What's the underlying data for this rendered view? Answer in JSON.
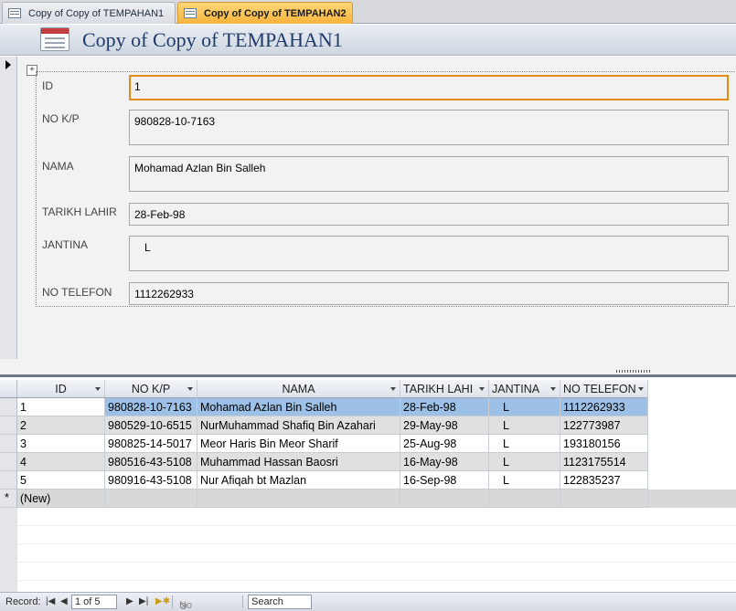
{
  "tabs": [
    {
      "label": "Copy of Copy of TEMPAHAN1",
      "active": false
    },
    {
      "label": "Copy of Copy of TEMPAHAN2",
      "active": true
    }
  ],
  "form": {
    "title": "Copy of Copy of TEMPAHAN1",
    "fields": {
      "id": {
        "label": "ID",
        "value": "1"
      },
      "nokp": {
        "label": "NO K/P",
        "value": "980828-10-7163"
      },
      "nama": {
        "label": "NAMA",
        "value": "Mohamad Azlan Bin Salleh"
      },
      "tarikh": {
        "label": "TARIKH LAHIR",
        "value": "28-Feb-98"
      },
      "jantina": {
        "label": "JANTINA",
        "value": "L"
      },
      "telefon": {
        "label": "NO TELEFON",
        "value": "1112262933"
      }
    }
  },
  "datasheet": {
    "columns": [
      "ID",
      "NO K/P",
      "NAMA",
      "TARIKH LAHI",
      "JANTINA",
      "NO TELEFON"
    ],
    "rows": [
      [
        "1",
        "980828-10-7163",
        "Mohamad Azlan Bin Salleh",
        "28-Feb-98",
        "L",
        "1112262933"
      ],
      [
        "2",
        "980529-10-6515",
        "NurMuhammad Shafiq Bin Azahari",
        "29-May-98",
        "L",
        "122773987"
      ],
      [
        "3",
        "980825-14-5017",
        "Meor Haris Bin Meor Sharif",
        "25-Aug-98",
        "L",
        "193180156"
      ],
      [
        "4",
        "980516-43-5108",
        "Muhammad Hassan Baosri",
        "16-May-98",
        "L",
        "1123175514"
      ],
      [
        "5",
        "980916-43-5108",
        "Nur Afiqah bt Mazlan",
        "16-Sep-98",
        "L",
        "122835237"
      ]
    ],
    "new_row_label": "(New)",
    "new_row_marker": "*"
  },
  "status": {
    "record_label": "Record:",
    "record_position": "1 of 5",
    "filter_label": "No Filter",
    "search_label": "Search"
  }
}
